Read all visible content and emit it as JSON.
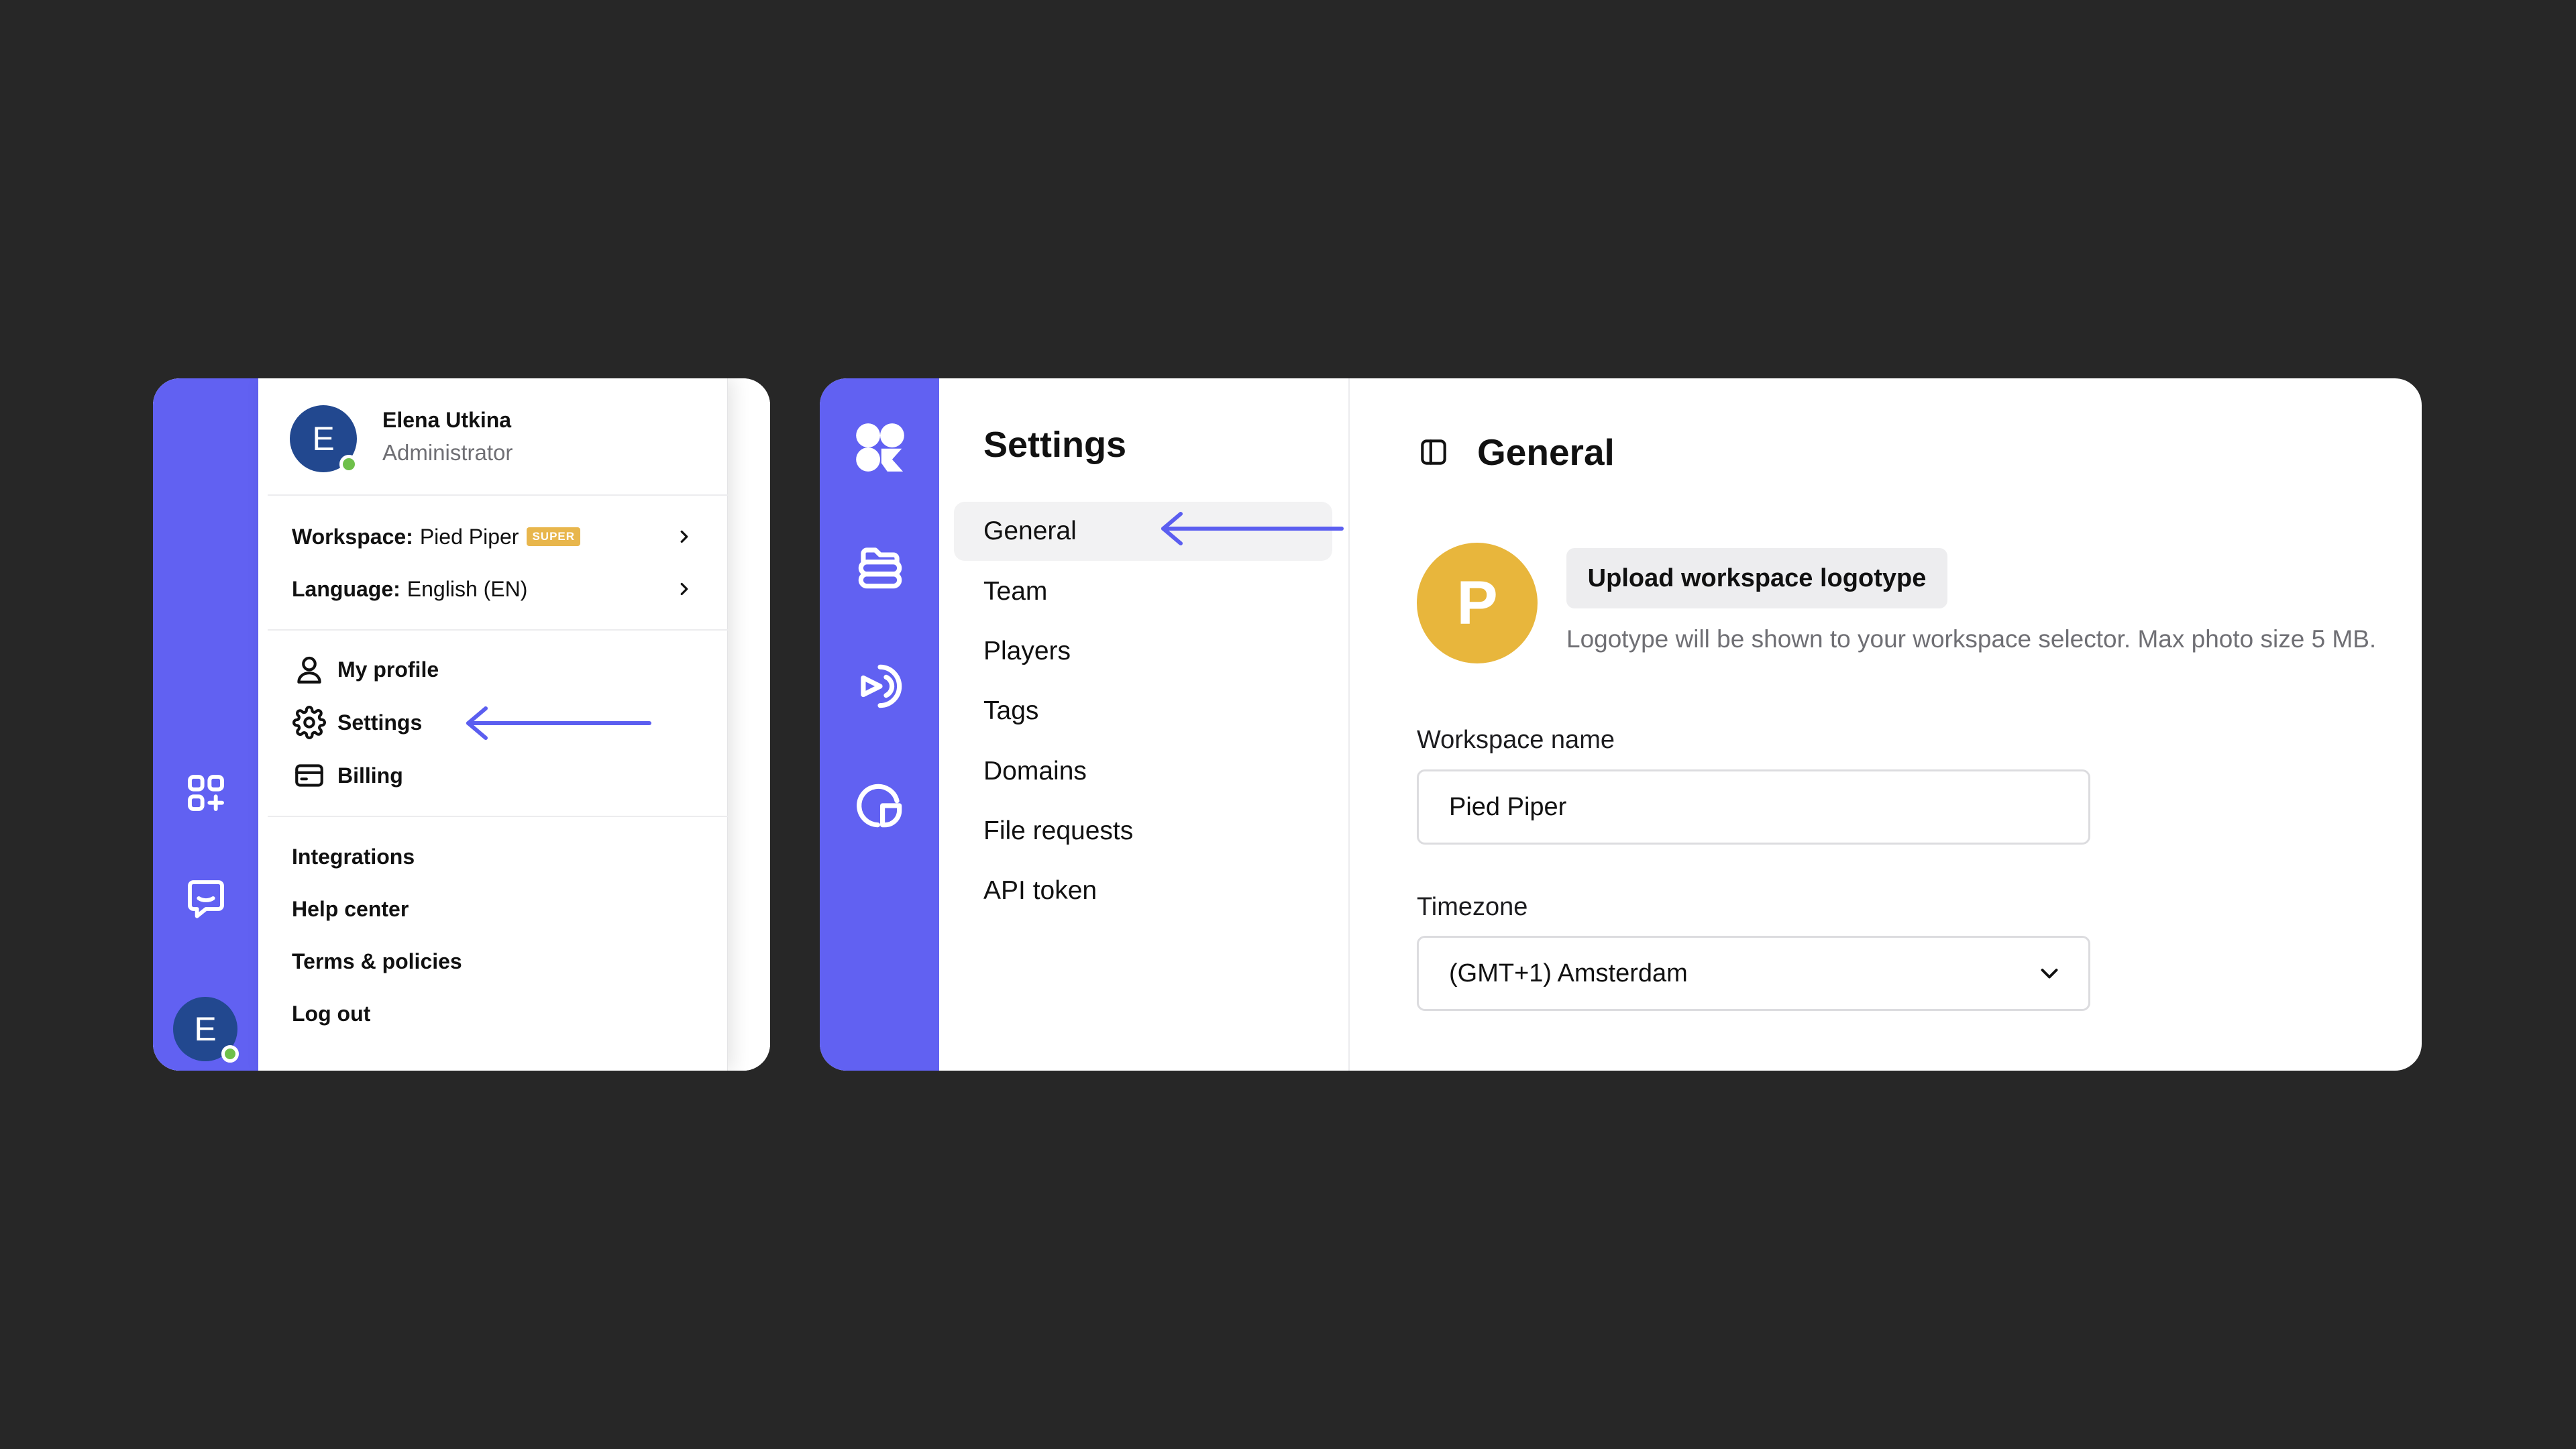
{
  "colors": {
    "background": "#272727",
    "rail": "#6161f2",
    "avatar": "#22488f",
    "online": "#6ec04a",
    "accent_logo": "#e8b63c",
    "badge": "#e8b64c",
    "arrow": "#5b5ef0"
  },
  "user_menu": {
    "rail": {
      "icons": [
        "apps-add-icon",
        "chat-icon"
      ],
      "avatar_letter": "E"
    },
    "header": {
      "avatar_letter": "E",
      "name": "Elena Utkina",
      "role": "Administrator"
    },
    "workspace": {
      "label": "Workspace:",
      "value": "Pied Piper",
      "badge": "SUPER"
    },
    "language": {
      "label": "Language:",
      "value": "English (EN)"
    },
    "account_items": [
      {
        "label": "My profile",
        "icon": "user-icon"
      },
      {
        "label": "Settings",
        "icon": "gear-icon"
      },
      {
        "label": "Billing",
        "icon": "credit-card-icon"
      }
    ],
    "footer_items": [
      {
        "label": "Integrations"
      },
      {
        "label": "Help center"
      },
      {
        "label": "Terms & policies"
      },
      {
        "label": "Log out"
      }
    ]
  },
  "settings": {
    "rail_icons": [
      "logo-icon",
      "folder-icon",
      "player-icon",
      "analytics-icon"
    ],
    "title": "Settings",
    "nav": [
      {
        "label": "General",
        "active": true
      },
      {
        "label": "Team"
      },
      {
        "label": "Players"
      },
      {
        "label": "Tags"
      },
      {
        "label": "Domains"
      },
      {
        "label": "File requests"
      },
      {
        "label": "API token"
      }
    ],
    "content": {
      "title": "General",
      "logo_letter": "P",
      "upload_label": "Upload workspace logotype",
      "upload_hint": "Logotype will be shown to your workspace selector. Max photo size 5 MB.",
      "workspace_name_label": "Workspace name",
      "workspace_name_value": "Pied Piper",
      "timezone_label": "Timezone",
      "timezone_value": "(GMT+1) Amsterdam"
    }
  }
}
